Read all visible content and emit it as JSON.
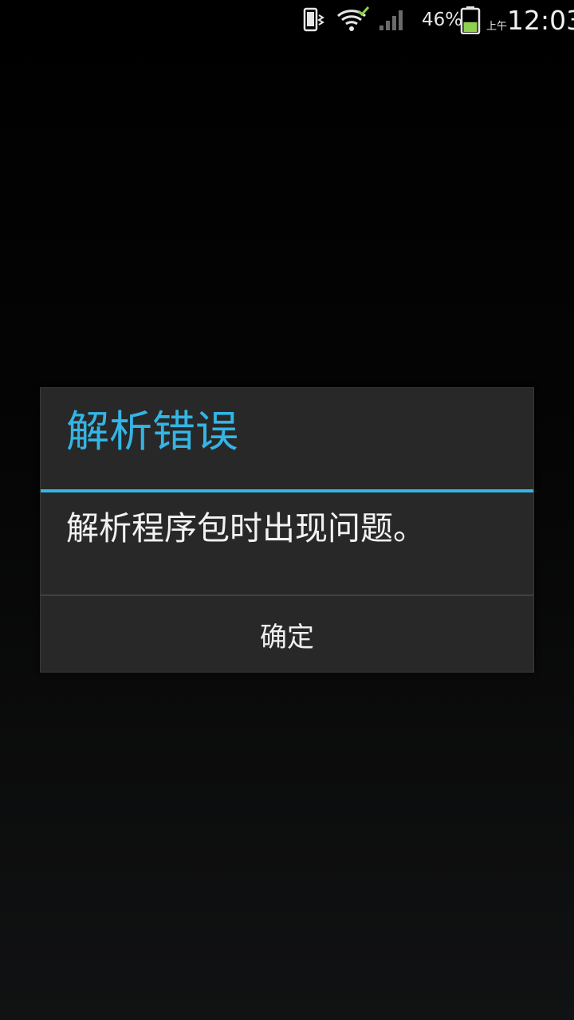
{
  "status_bar": {
    "icons": [
      "vibrate-icon",
      "wifi-icon",
      "signal-icon",
      "battery-icon"
    ],
    "battery_percent": "46%",
    "battery_level": 0.46,
    "ampm": "上午",
    "time": "12:03",
    "battery_color": "#8fd14f",
    "wifi_check_color": "#8fd14f"
  },
  "dialog": {
    "title": "解析错误",
    "message": "解析程序包时出现问题。",
    "ok_label": "确定",
    "accent_color": "#33b5e5"
  }
}
